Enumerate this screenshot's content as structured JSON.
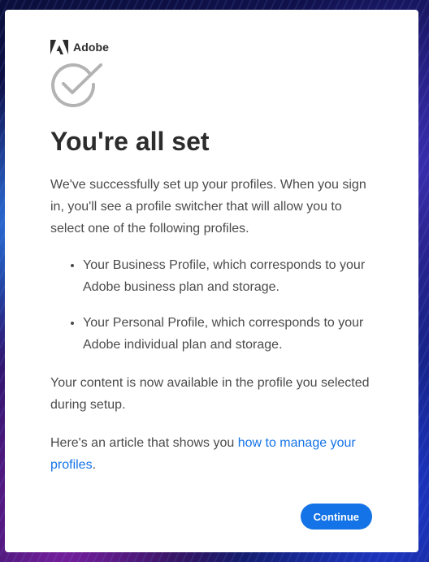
{
  "brand": {
    "name": "Adobe",
    "icon": "adobe-logo-icon",
    "color": "#2c2c2c"
  },
  "status_icon": "checkmark-circle-icon",
  "title": "You're all set",
  "intro": "We've successfully set up your profiles. When you sign in, you'll see a profile switcher that will allow you to select one of the following profiles.",
  "profiles": [
    "Your Business Profile, which corresponds to your Adobe business plan and storage.",
    "Your Personal Profile, which corresponds to your Adobe individual plan and storage."
  ],
  "content_note": "Your content is now available in the profile you selected during setup.",
  "article": {
    "prefix": "Here's an article that shows you ",
    "link_text": "how to manage your profiles",
    "suffix": "."
  },
  "continue_label": "Continue",
  "colors": {
    "accent": "#1473e6",
    "heading": "#2c2c2c",
    "body_text": "#4b4b4b",
    "check_icon": "#b3b3b3"
  }
}
